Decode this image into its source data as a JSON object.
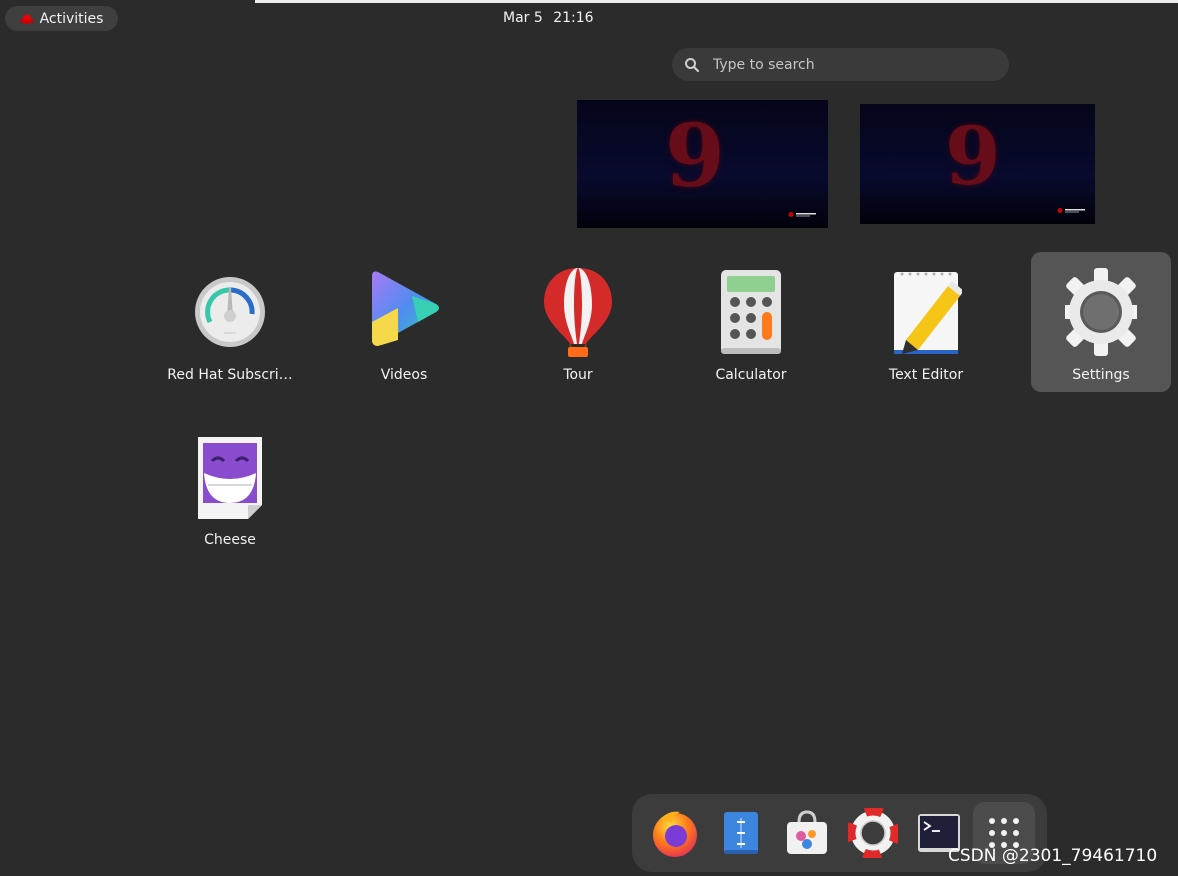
{
  "top_bar": {
    "activities_label": "Activities",
    "date": "Mar 5",
    "time": "21:16"
  },
  "search": {
    "placeholder": "Type to search",
    "icon": "search-icon"
  },
  "workspaces": [
    {
      "label": "9"
    },
    {
      "label": "9"
    }
  ],
  "apps": [
    {
      "name": "Red Hat Subscri…",
      "icon": "gauge-icon"
    },
    {
      "name": "Videos",
      "icon": "play-icon"
    },
    {
      "name": "Tour",
      "icon": "balloon-icon"
    },
    {
      "name": "Calculator",
      "icon": "calculator-icon"
    },
    {
      "name": "Text Editor",
      "icon": "notepad-pencil-icon"
    },
    {
      "name": "Settings",
      "icon": "gear-icon",
      "selected": true
    },
    {
      "name": "Cheese",
      "icon": "cheese-face-icon"
    }
  ],
  "dash": {
    "items": [
      "firefox-icon",
      "files-icon",
      "software-icon",
      "help-icon",
      "terminal-icon",
      "show-apps-icon"
    ]
  },
  "watermark": "CSDN @2301_79461710",
  "colors": {
    "background": "#2b2b2b",
    "selected_tile": "#555555",
    "dash": "#3c3c3c",
    "accent_red": "#cc0000"
  }
}
